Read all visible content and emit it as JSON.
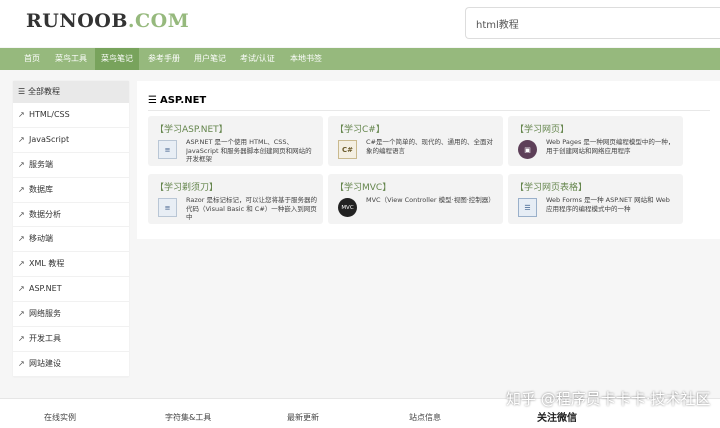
{
  "header": {
    "logo_main": "RUNOOB",
    "logo_dot": ".",
    "logo_tld": "COM",
    "search_value": "html教程"
  },
  "nav": {
    "items": [
      "首页",
      "菜鸟工具",
      "菜鸟笔记",
      "参考手册",
      "用户笔记",
      "考试/认证",
      "本地书签"
    ],
    "active_index": 2
  },
  "sidebar": {
    "heading": "全部教程",
    "items": [
      "HTML/CSS",
      "JavaScript",
      "服务端",
      "数据库",
      "数据分析",
      "移动端",
      "XML 教程",
      "ASP.NET",
      "网络服务",
      "开发工具",
      "网站建设"
    ]
  },
  "main": {
    "title": "ASP.NET",
    "cards": [
      {
        "title": "【学习ASP.NET】",
        "desc": "ASP.NET 是一个使用 HTML、CSS、JavaScript 和服务器脚本创建网页和网站的开发框架",
        "icon": "document-icon"
      },
      {
        "title": "【学习C#】",
        "desc": "C#是一个简单的、现代的、通用的、全面对象的编程语言",
        "icon": "csharp-icon"
      },
      {
        "title": "【学习网页】",
        "desc": "Web Pages 是一种网页编程模型中的一种，用于创建网站和网络应用程序",
        "icon": "webpages-icon"
      },
      {
        "title": "【学习剃须刀】",
        "desc": "Razor 是标记标记，可以让您将基于服务器的代码（Visual Basic 和 C#）一种嵌入到网页中",
        "icon": "document-icon"
      },
      {
        "title": "【学习MVC】",
        "desc": "MVC（View Controller 模型·视图·控制器）",
        "icon": "mvc-icon"
      },
      {
        "title": "【学习网页表格】",
        "desc": "Web Forms 是一种 ASP.NET 网站和 Web 应用程序的编程模式中的一种",
        "icon": "webforms-icon"
      }
    ],
    "icon_labels": {
      "csharp": "C#",
      "mvc": "MVC"
    }
  },
  "footer": {
    "items": [
      "在线实例",
      "字符集&工具",
      "最新更新",
      "站点信息",
      "关注微信"
    ]
  },
  "watermark": "知乎 @程序员卡卡卡·技术社区",
  "colors": {
    "nav": "#96b97d",
    "nav_active": "#78a35c",
    "card_title": "#64854c"
  }
}
